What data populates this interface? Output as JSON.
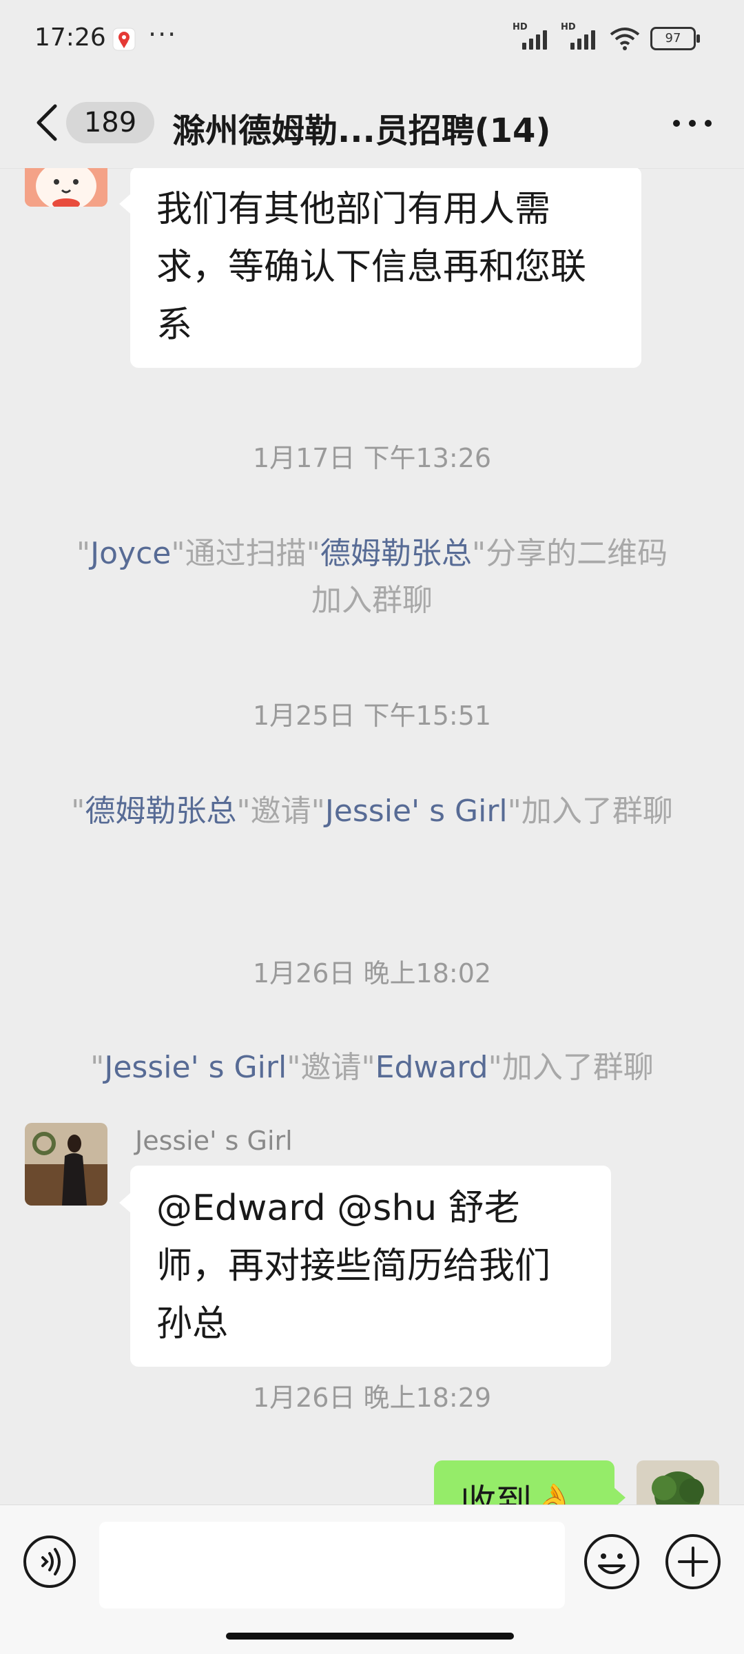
{
  "status_bar": {
    "time": "17:26",
    "more": "···",
    "hd1": "HD",
    "hd2": "HD",
    "battery": "97"
  },
  "header": {
    "unread_count": "189",
    "title": "滁州德姆勒...员招聘(14)"
  },
  "messages": {
    "first_bubble": "我们有其他部门有用人需求，等确认下信息再和您联系",
    "time1": "1月17日 下午13:26",
    "sys1": {
      "q1": "\"",
      "name1": "Joyce",
      "t1": "\"通过扫描\"",
      "name2": "德姆勒张总",
      "t2": "\"分享的二维码加入群聊"
    },
    "time2": "1月25日 下午15:51",
    "sys2": {
      "q1": "\"",
      "name1": "德姆勒张总",
      "t1": "\"邀请\"",
      "name2": "Jessie' s Girl",
      "t2": "\"加入了群聊"
    },
    "time3": "1月26日 晚上18:02",
    "sys3": {
      "q1": "\"",
      "name1": "Jessie' s Girl",
      "t1": "\"邀请\"",
      "name2": "Edward",
      "t2": "\"加入了群聊"
    },
    "sender": "Jessie' s Girl",
    "jessie_bubble": "@Edward @shu  舒老师，再对接些简历给我们孙总",
    "time4": "1月26日 晚上18:29",
    "my_bubble": "收到👌"
  },
  "colors": {
    "background": "#EDEDED",
    "name_link": "#576B95",
    "my_bubble": "#95EC69",
    "system_text": "#A8A8A8"
  },
  "input_bar": {
    "voice_icon": "voice-icon",
    "emoji_icon": "emoji-icon",
    "plus_icon": "plus-icon"
  }
}
